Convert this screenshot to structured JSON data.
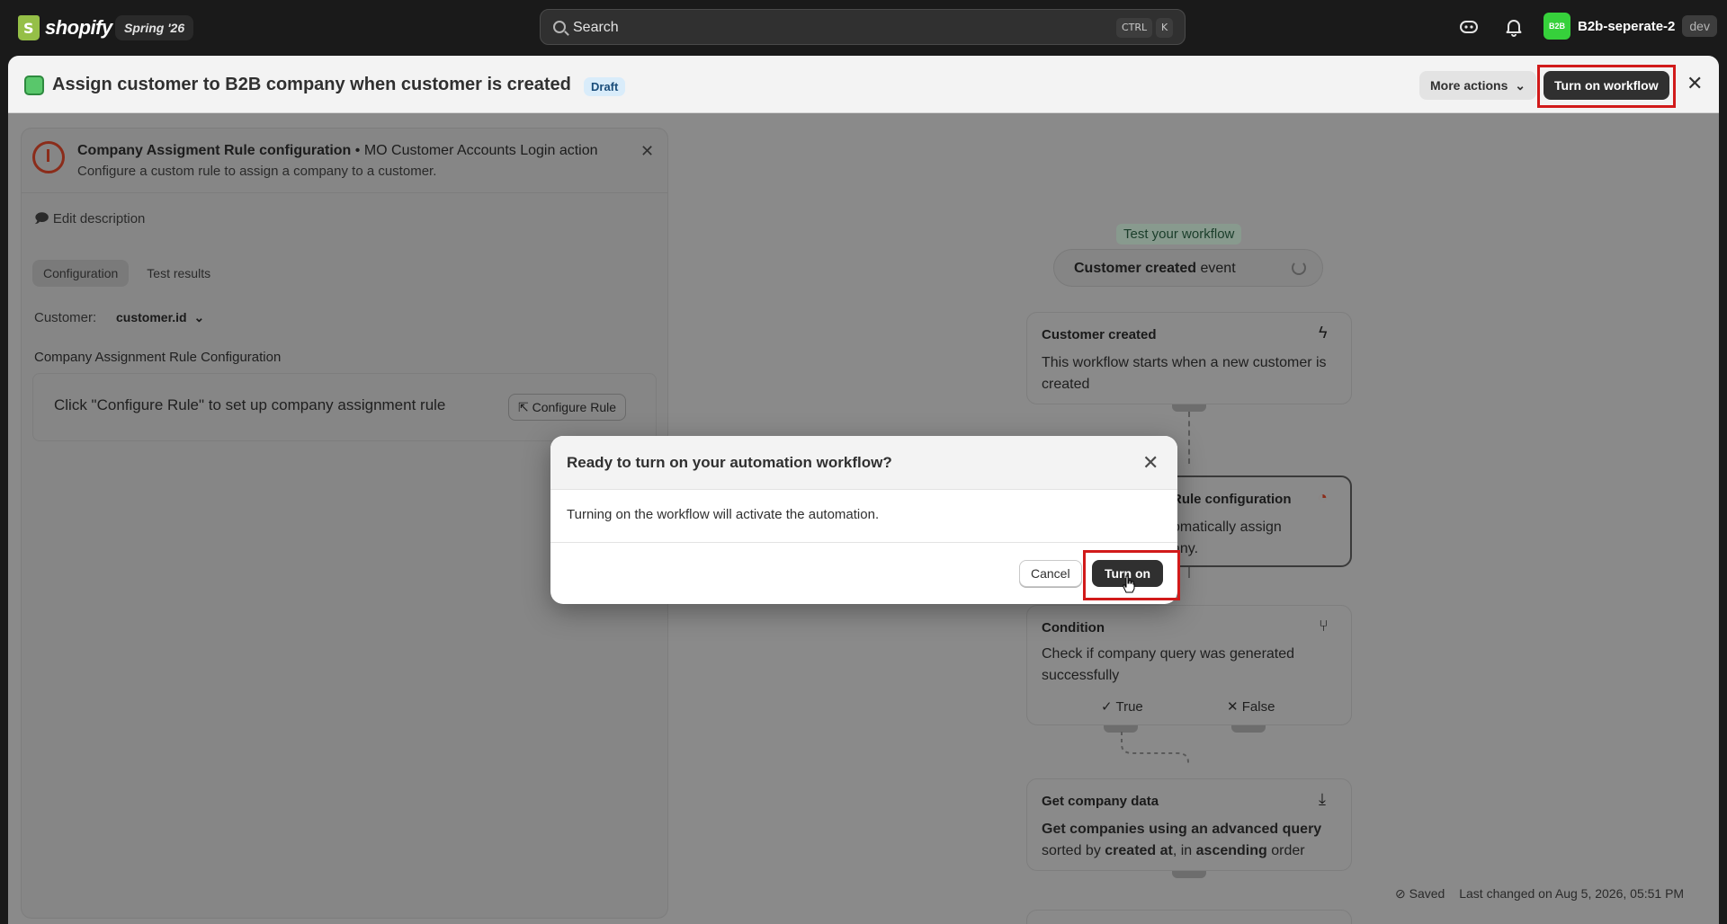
{
  "topbar": {
    "logo_text": "shopify",
    "edition": "Spring '26",
    "search_placeholder": "Search",
    "kbd_ctrl": "CTRL",
    "kbd_k": "K",
    "store_avatar": "B2B",
    "store_name": "B2b-seperate-2",
    "store_badge": "dev"
  },
  "header": {
    "title": "Assign customer to B2B company when customer is created",
    "badge": "Draft",
    "more_actions": "More actions",
    "turn_on_workflow": "Turn on workflow"
  },
  "side_panel": {
    "title": "Company Assigment Rule configuration",
    "app_name": "MO Customer Accounts Login action",
    "subtitle": "Configure a custom rule to assign a company to a customer.",
    "edit_description": "Edit description",
    "tabs": [
      {
        "label": "Configuration",
        "active": true
      },
      {
        "label": "Test results",
        "active": false
      }
    ],
    "customer_label": "Customer:",
    "customer_value": "customer.id",
    "rule_section_label": "Company Assignment Rule Configuration",
    "rule_text": "Click \"Configure Rule\" to set up company assignment rule",
    "configure_button": "Configure Rule"
  },
  "canvas": {
    "test_label": "Test your workflow",
    "event_bold": "Customer created",
    "event_rest": " event",
    "cards": [
      {
        "title": "Customer created",
        "body": "This workflow starts when a new customer is created"
      },
      {
        "title": "Rule configuration",
        "body_1": "omatically assign",
        "body_2": "any."
      },
      {
        "title": "Condition",
        "body": "Check if company query was generated successfully",
        "true_label": "True",
        "false_label": "False"
      },
      {
        "title": "Get company data",
        "body_bold": "Get companies using an advanced query",
        "body_rest_1": "sorted by ",
        "body_bold_2": "created at",
        "body_rest_2": ", in ",
        "body_bold_3": "ascending",
        "body_rest_3": " order"
      }
    ],
    "status_saved": "Saved",
    "status_changed": "Last changed on Aug 5, 2026, 05:51 PM"
  },
  "modal": {
    "title": "Ready to turn on your automation workflow?",
    "body": "Turning on the workflow will activate the automation.",
    "cancel": "Cancel",
    "confirm": "Turn on"
  },
  "colors": {
    "highlight": "#d11a1a",
    "primary_button": "#303030",
    "store_avatar": "#36d13b"
  }
}
